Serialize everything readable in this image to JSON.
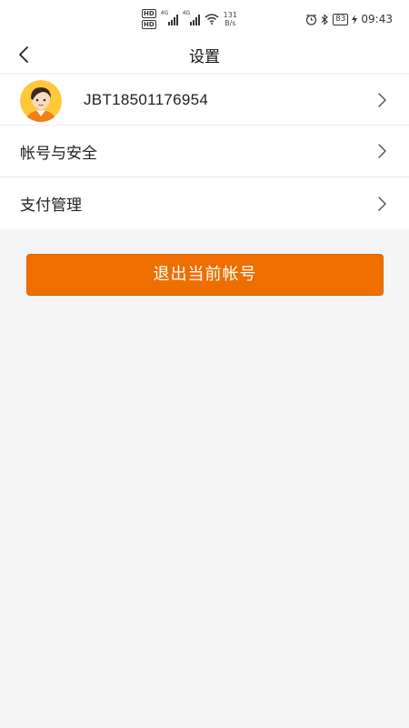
{
  "status_bar": {
    "hd_top": "HD",
    "hd_bottom": "HD",
    "sig1_label": "4G",
    "sig2_label": "4G",
    "speed_value": "131",
    "speed_unit": "B/s",
    "battery": "83",
    "time": "09:43"
  },
  "nav": {
    "title": "设置"
  },
  "profile": {
    "username": "JBT18501176954"
  },
  "menu": {
    "account_security": "帐号与安全",
    "payment_management": "支付管理"
  },
  "actions": {
    "logout_label": "退出当前帐号"
  },
  "colors": {
    "accent": "#ee6e00",
    "background": "#f5f5f5",
    "surface": "#ffffff"
  }
}
